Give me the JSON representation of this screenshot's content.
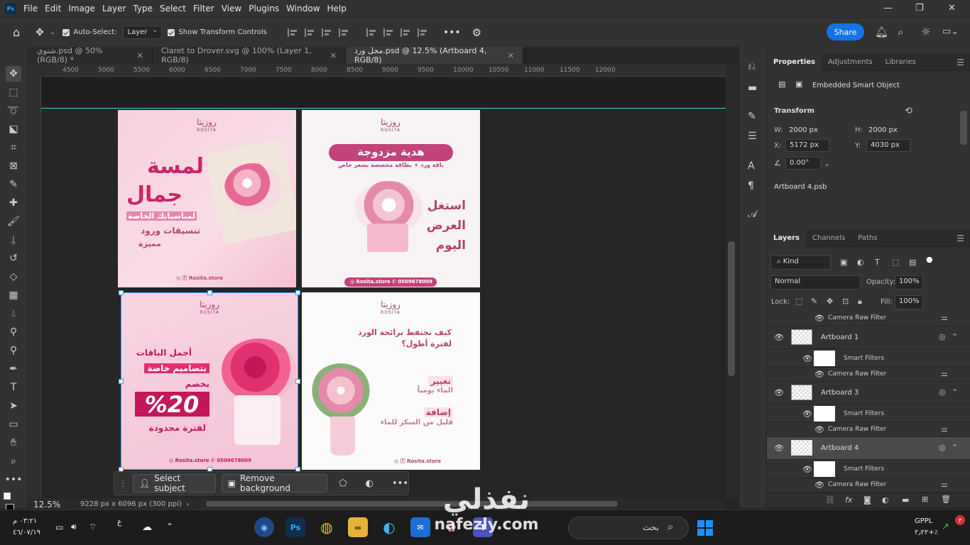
{
  "menubar": {
    "logo": "Ps",
    "items": [
      "File",
      "Edit",
      "Image",
      "Layer",
      "Type",
      "Select",
      "Filter",
      "View",
      "Plugins",
      "Window",
      "Help"
    ]
  },
  "options": {
    "auto_select_label": "Auto-Select:",
    "auto_select_value": "Layer",
    "transform_controls_label": "Show Transform Controls",
    "share_label": "Share"
  },
  "tabs": [
    {
      "label": "شتوي.psd @ 50% (RGB/8) *"
    },
    {
      "label": "Claret to Drover.svg @ 100% (Layer 1, RGB/8)"
    },
    {
      "label": "محل ورد.psd @ 12.5% (Artboard 4, RGB/8)"
    }
  ],
  "ruler": [
    "4500",
    "5000",
    "5500",
    "6000",
    "6500",
    "7000",
    "7500",
    "8000",
    "8500",
    "9000",
    "9500",
    "10000",
    "10500",
    "11000",
    "11500",
    "12000"
  ],
  "artboards": {
    "ab1": {
      "logo": "روزيتا",
      "logo_sub": "ROSITA",
      "line1": "لمسة",
      "line2": "جمال",
      "line3": "لمناسباتك الخاصة",
      "line4": "تنسيقات ورود",
      "line5": "مميزة",
      "footer": "Rosita.store"
    },
    "ab2": {
      "logo": "روزيتا",
      "logo_sub": "ROSITA",
      "title": "هدية مزدوجة",
      "subtitle": "باقة ورد + بطاقة مخصصة بسعر خاص",
      "l1": "استغل",
      "l2": "العرض",
      "l3": "اليوم",
      "footer_site": "Rosita.store",
      "footer_phone": "0509678009"
    },
    "ab3": {
      "logo": "روزيتا",
      "logo_sub": "ROSITA",
      "l1": "أجمل الباقات",
      "l2": "بتصاميم خاصة",
      "l3": "بخصم",
      "discount": "%20",
      "l4": "لفترة محدودة",
      "footer_site": "Rosita.store",
      "footer_phone": "0509678009"
    },
    "ab4": {
      "logo": "روزيتا",
      "logo_sub": "ROSITA",
      "title": "كيف تحتفظ برائحة الورد",
      "title2": "لفترة أطول؟",
      "t1": "تغيير",
      "t1s": "الماء يومياً",
      "t2": "إضافة",
      "t2s": "قليل من السكر للماء",
      "footer": "Rosita.store"
    }
  },
  "context_bar": {
    "select_subject": "Select subject",
    "remove_background": "Remove background"
  },
  "status": {
    "zoom": "12.5%",
    "doc_size": "9228 px x 6096 px (300 ppi)"
  },
  "properties": {
    "tabs": [
      "Properties",
      "Adjustments",
      "Libraries"
    ],
    "kind": "Embedded Smart Object",
    "transform_label": "Transform",
    "w_label": "W:",
    "w": "2000 px",
    "h_label": "H:",
    "h": "2000 px",
    "x_label": "X:",
    "x": "5172 px",
    "y_label": "Y:",
    "y": "4030 px",
    "angle": "0.00°",
    "file": "Artboard 4.psb"
  },
  "layers": {
    "tabs": [
      "Layers",
      "Channels",
      "Paths"
    ],
    "kind_filter": "Kind",
    "blend": "Normal",
    "opacity_label": "Opacity:",
    "opacity": "100%",
    "lock_label": "Lock:",
    "fill_label": "Fill:",
    "fill": "100%",
    "rows": [
      {
        "name": "Camera Raw Filter"
      },
      {
        "name": "Artboard 1"
      },
      {
        "name": "Smart Filters"
      },
      {
        "name": "Camera Raw Filter"
      },
      {
        "name": "Artboard 3"
      },
      {
        "name": "Smart Filters"
      },
      {
        "name": "Camera Raw Filter"
      },
      {
        "name": "Artboard 4"
      },
      {
        "name": "Smart Filters"
      },
      {
        "name": "Camera Raw Filter"
      }
    ]
  },
  "taskbar": {
    "time": "٠٣:٢١ م",
    "date": "٤٦/٠٧/١٩",
    "lang": "ع",
    "search": "بحث",
    "stock": "GPPL",
    "stock_val": "٢٫٢٢+٪"
  },
  "watermark": {
    "ar": "نفذلي",
    "en": "nafezly.com"
  },
  "colors": {
    "accent": "#1473e6",
    "brand_pink": "#b54270",
    "guide": "#3fd0e0"
  }
}
